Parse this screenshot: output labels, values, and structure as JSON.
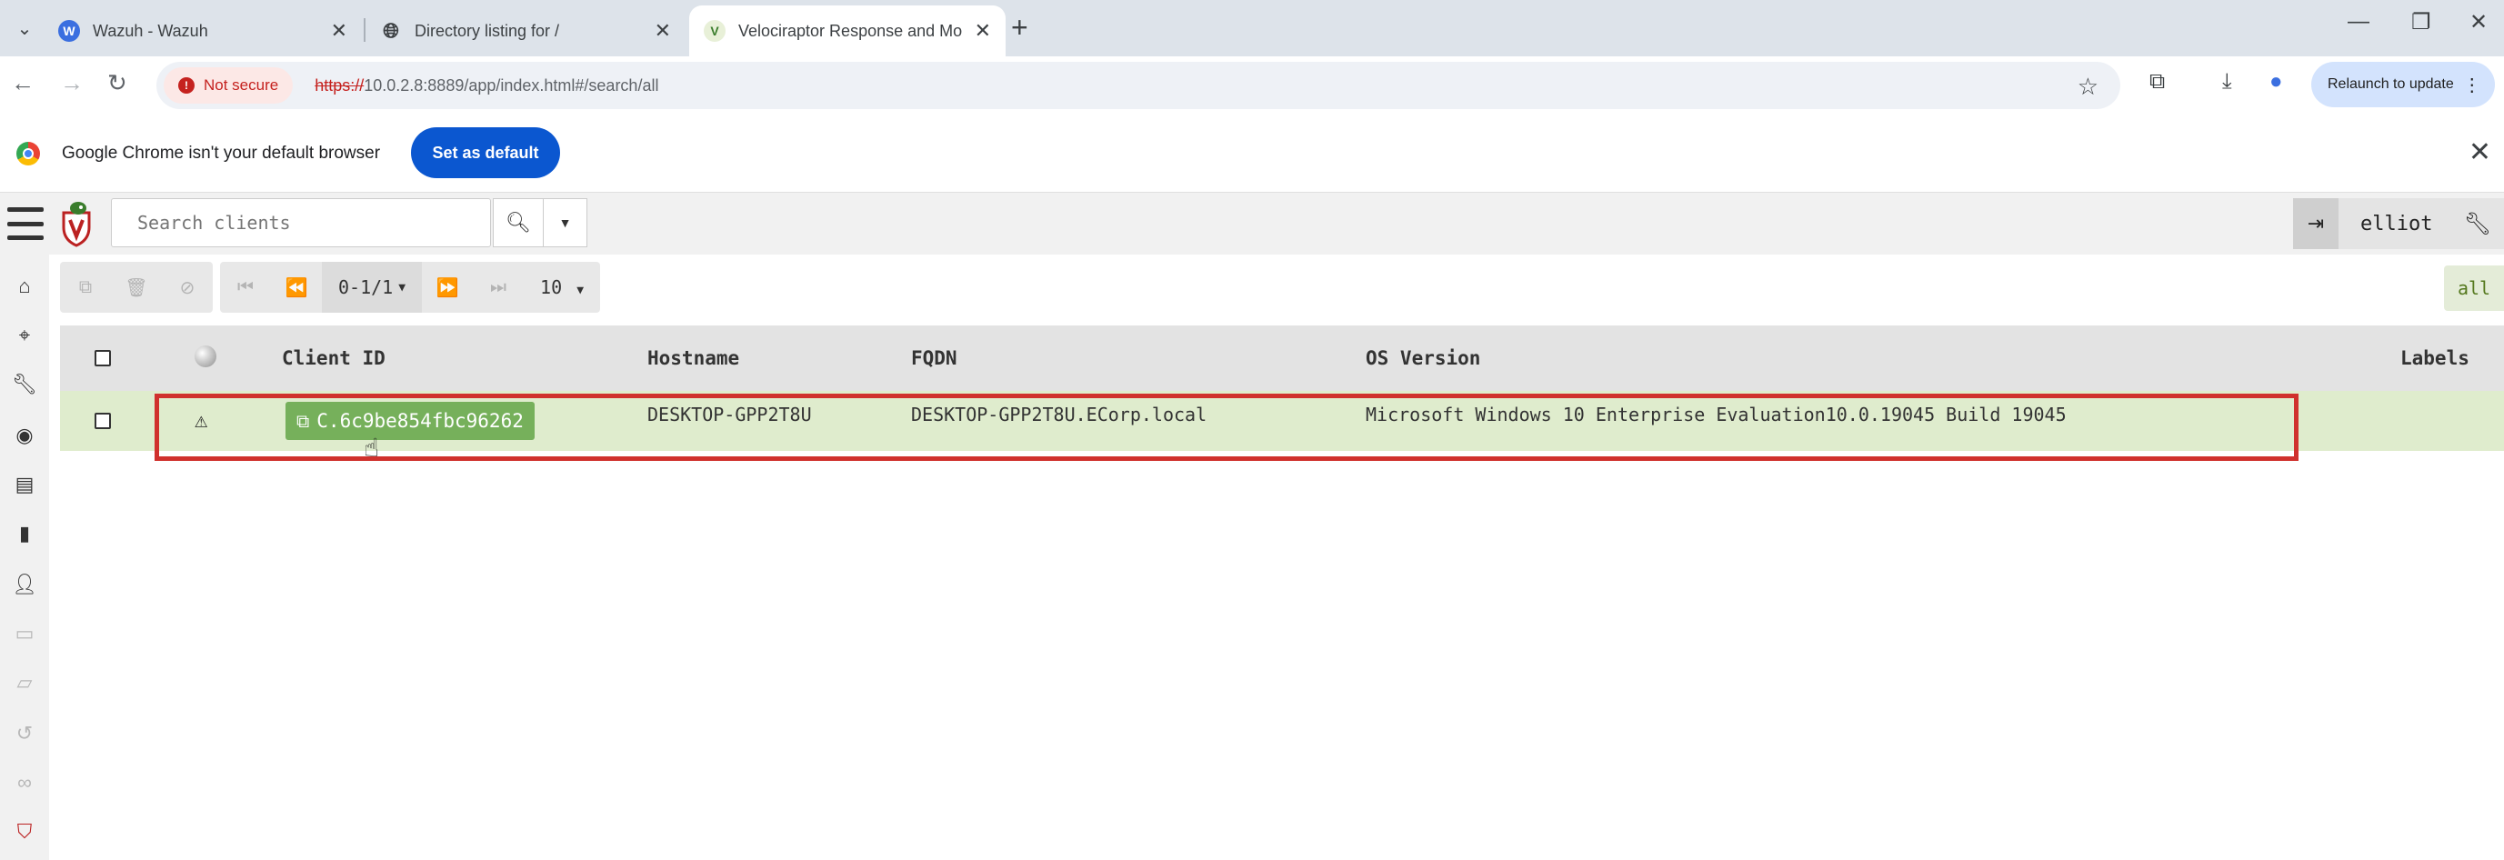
{
  "browser": {
    "tabs": [
      {
        "title": "Wazuh - Wazuh",
        "favicon": "wazuh-icon"
      },
      {
        "title": "Directory listing for /",
        "favicon": "globe-icon"
      },
      {
        "title": "Velociraptor Response and Mo",
        "favicon": "velociraptor-icon"
      }
    ],
    "security_label": "Not secure",
    "url_scheme": "https://",
    "url_rest": "10.0.2.8:8889/app/index.html#/search/all",
    "relaunch_label": "Relaunch to update"
  },
  "infobar": {
    "message": "Google Chrome isn't your default browser",
    "button_label": "Set as default"
  },
  "app": {
    "search_placeholder": "Search clients",
    "username": "elliot",
    "pager_label": "0-1/1",
    "page_size": "10",
    "filter_badge": "all",
    "table": {
      "headers": [
        "Client ID",
        "Hostname",
        "FQDN",
        "OS Version",
        "Labels"
      ],
      "rows": [
        {
          "client_id": "C.6c9be854fbc96262",
          "hostname": "DESKTOP-GPP2T8U",
          "fqdn": "DESKTOP-GPP2T8U.ECorp.local",
          "os_version": "Microsoft Windows 10 Enterprise Evaluation10.0.19045 Build 19045",
          "labels": ""
        }
      ]
    }
  },
  "colors": {
    "row_highlight": "#dfeccd",
    "client_button": "#76b05b",
    "annotation_box": "#d0312d",
    "chrome_accent": "#0b57d0"
  }
}
